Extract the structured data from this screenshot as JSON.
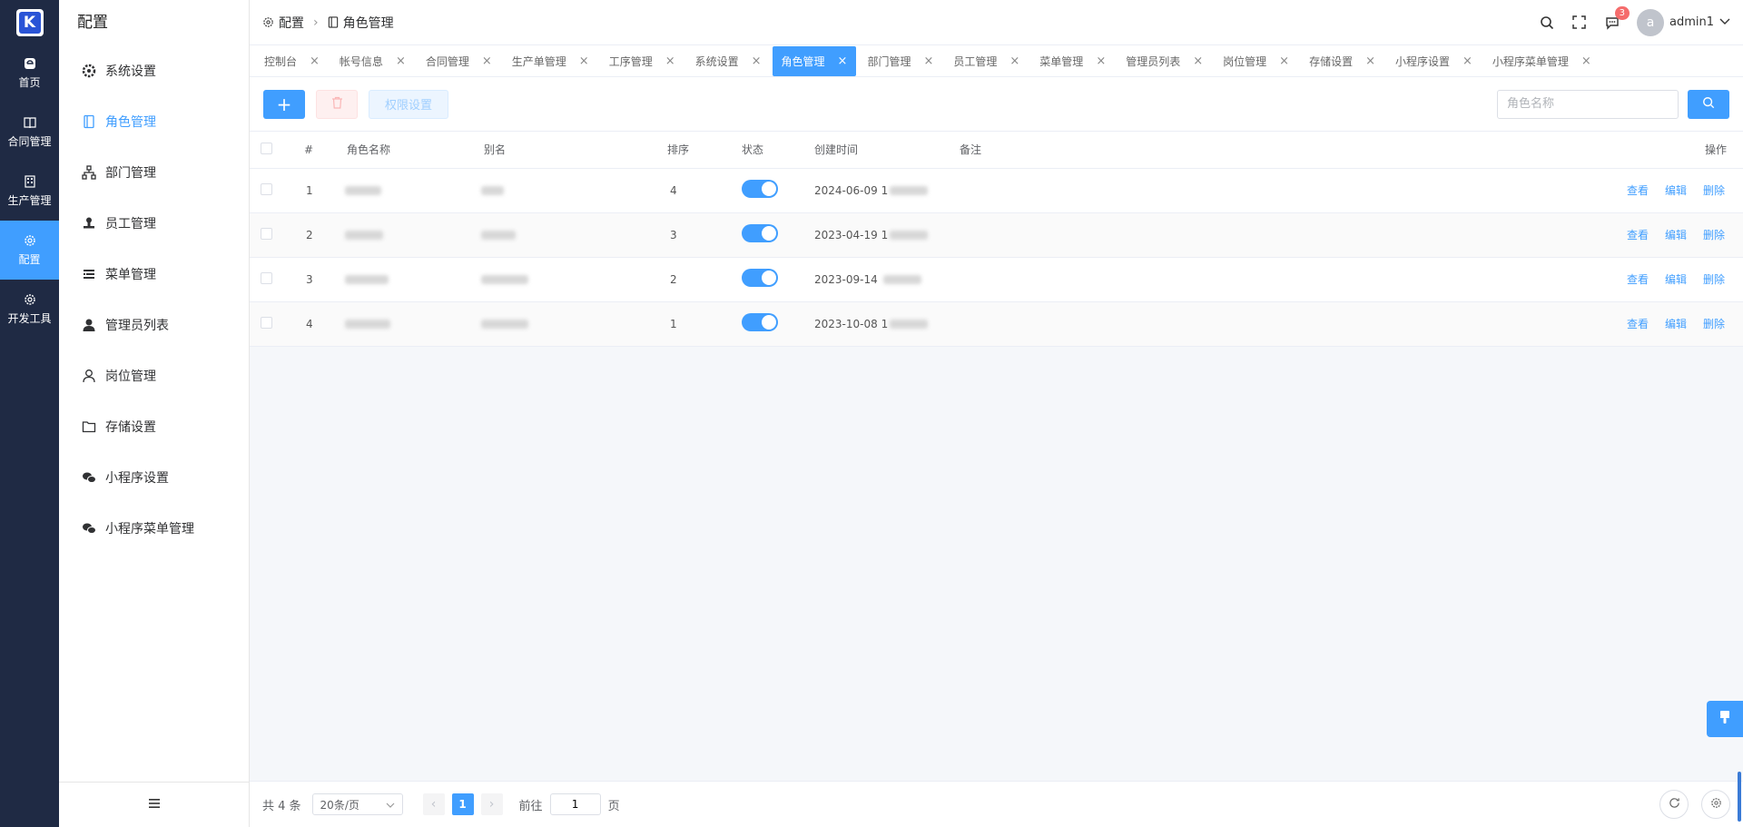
{
  "rail": {
    "items": [
      {
        "label": "首页",
        "icon": "home-icon"
      },
      {
        "label": "合同管理",
        "icon": "book-icon"
      },
      {
        "label": "生产管理",
        "icon": "building-icon"
      },
      {
        "label": "配置",
        "icon": "gear-icon"
      },
      {
        "label": "开发工具",
        "icon": "gear-icon"
      }
    ],
    "active_index": 3
  },
  "sidebar": {
    "title": "配置",
    "items": [
      {
        "label": "系统设置",
        "icon": "gear-icon"
      },
      {
        "label": "角色管理",
        "icon": "book-icon"
      },
      {
        "label": "部门管理",
        "icon": "org-icon"
      },
      {
        "label": "员工管理",
        "icon": "stamp-icon"
      },
      {
        "label": "菜单管理",
        "icon": "menu-icon"
      },
      {
        "label": "管理员列表",
        "icon": "user-icon"
      },
      {
        "label": "岗位管理",
        "icon": "user-outline-icon"
      },
      {
        "label": "存储设置",
        "icon": "folder-icon"
      },
      {
        "label": "小程序设置",
        "icon": "wechat-icon"
      },
      {
        "label": "小程序菜单管理",
        "icon": "wechat-icon"
      }
    ],
    "active_index": 1
  },
  "header": {
    "breadcrumb": [
      "配置",
      "角色管理"
    ],
    "notification_count": "3",
    "avatar_letter": "a",
    "username": "admin1"
  },
  "tabs": [
    {
      "label": "控制台"
    },
    {
      "label": "帐号信息"
    },
    {
      "label": "合同管理"
    },
    {
      "label": "生产单管理"
    },
    {
      "label": "工序管理"
    },
    {
      "label": "系统设置"
    },
    {
      "label": "角色管理"
    },
    {
      "label": "部门管理"
    },
    {
      "label": "员工管理"
    },
    {
      "label": "菜单管理"
    },
    {
      "label": "管理员列表"
    },
    {
      "label": "岗位管理"
    },
    {
      "label": "存储设置"
    },
    {
      "label": "小程序设置"
    },
    {
      "label": "小程序菜单管理"
    }
  ],
  "active_tab_index": 6,
  "toolbar": {
    "add_label": "+",
    "perm_label": "权限设置",
    "search_placeholder": "角色名称"
  },
  "table": {
    "columns": [
      "#",
      "角色名称",
      "别名",
      "排序",
      "状态",
      "创建时间",
      "备注",
      "操作"
    ],
    "rows": [
      {
        "index": "1",
        "sort": "4",
        "status": true,
        "created_date": "2024-06-09",
        "created_prefix": "1"
      },
      {
        "index": "2",
        "sort": "3",
        "status": true,
        "created_date": "2023-04-19",
        "created_prefix": "1"
      },
      {
        "index": "3",
        "sort": "2",
        "status": true,
        "created_date": "2023-09-14",
        "created_prefix": ""
      },
      {
        "index": "4",
        "sort": "1",
        "status": true,
        "created_date": "2023-10-08",
        "created_prefix": "1"
      }
    ],
    "actions": [
      "查看",
      "编辑",
      "删除"
    ]
  },
  "pagination": {
    "total_text": "共 4 条",
    "page_size": "20条/页",
    "current_page": "1",
    "goto_label": "前往",
    "goto_value": "1",
    "page_suffix": "页"
  },
  "colors": {
    "primary": "#409eff",
    "rail_bg": "#1f2a44",
    "danger_light": "#fef0f0"
  }
}
